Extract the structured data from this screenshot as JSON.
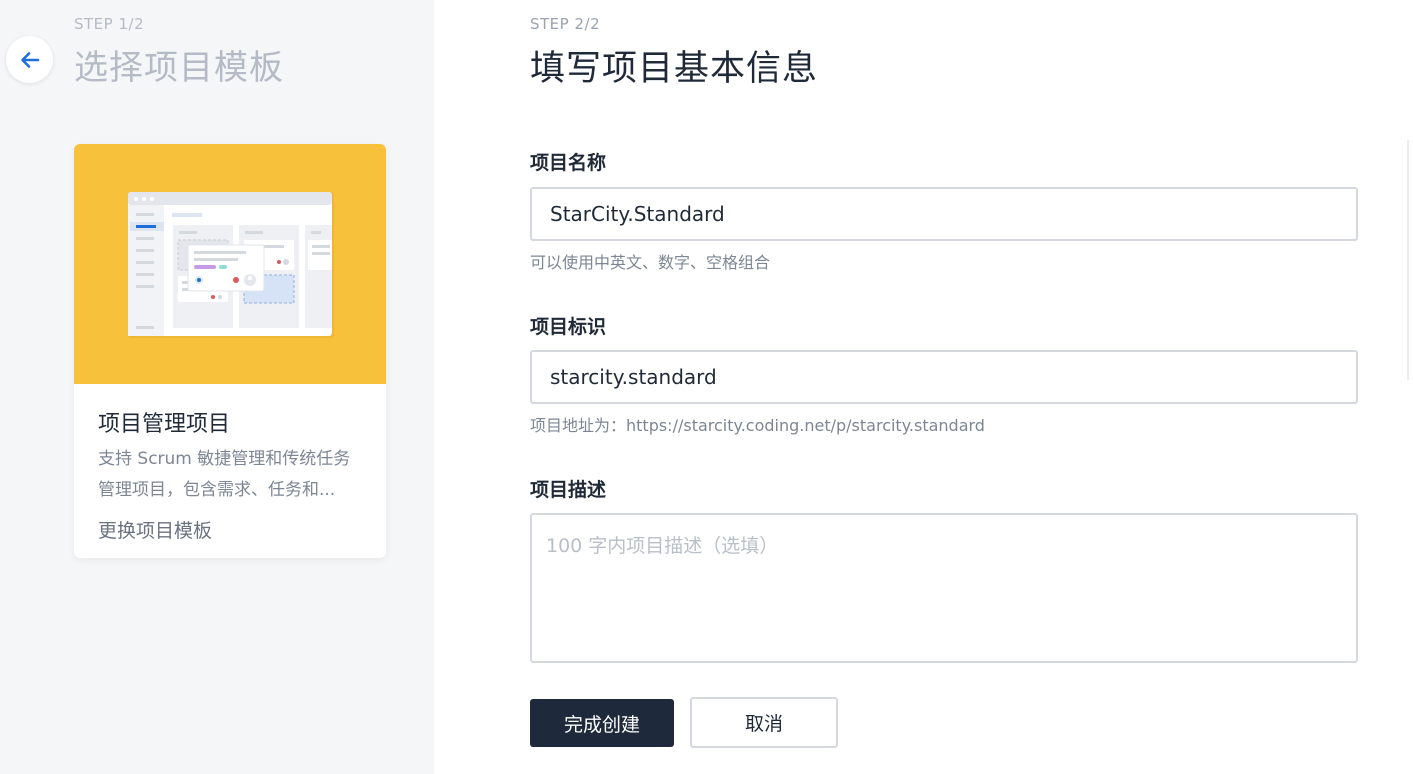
{
  "step1": {
    "label": "STEP 1/2",
    "title": "选择项目模板",
    "back_icon": "arrow-left-icon",
    "card": {
      "title": "项目管理项目",
      "description": "支持 Scrum 敏捷管理和传统任务管理项目，包含需求、任务和...",
      "change_link": "更换项目模板",
      "banner_color": "#f8c13c",
      "illustration": "project-board-illustration"
    }
  },
  "step2": {
    "label": "STEP 2/2",
    "title": "填写项目基本信息",
    "fields": {
      "name": {
        "label": "项目名称",
        "value": "StarCity.Standard",
        "hint": "可以使用中英文、数字、空格组合"
      },
      "identifier": {
        "label": "项目标识",
        "value": "starcity.standard",
        "hint": "项目地址为：https://starcity.coding.net/p/starcity.standard"
      },
      "description": {
        "label": "项目描述",
        "value": "",
        "placeholder": "100 字内项目描述（选填）"
      }
    },
    "buttons": {
      "submit": "完成创建",
      "cancel": "取消"
    }
  },
  "colors": {
    "accent": "#1e6fd9",
    "primary_button": "#1e2a3b",
    "banner": "#f8c13c"
  }
}
